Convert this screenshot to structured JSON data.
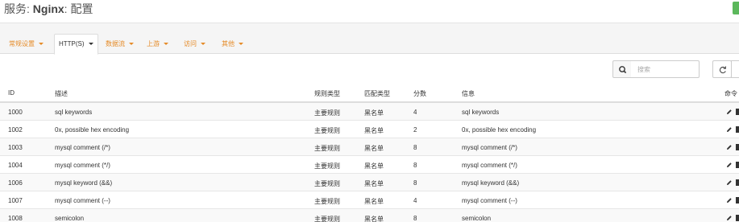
{
  "header": {
    "prefix": "服务: ",
    "service": "Nginx",
    "suffix": ": 配置"
  },
  "tabs": [
    {
      "label": "常规设置",
      "active": false
    },
    {
      "label": "HTTP(S)",
      "active": true
    },
    {
      "label": "数据流",
      "active": false
    },
    {
      "label": "上游",
      "active": false
    },
    {
      "label": "访问",
      "active": false
    },
    {
      "label": "其他",
      "active": false
    }
  ],
  "search": {
    "placeholder": "搜索",
    "icon": "search-icon"
  },
  "refresh_icon": "refresh-icon",
  "table": {
    "columns": {
      "id": "ID",
      "description": "描述",
      "rule_type": "规则类型",
      "match_type": "匹配类型",
      "score": "分数",
      "message": "信息",
      "commands": "命令"
    },
    "rows": [
      {
        "id": "1000",
        "description": "sql keywords",
        "rule_type": "主要规则",
        "match_type": "黑名单",
        "score": "4",
        "message": "sql keywords"
      },
      {
        "id": "1002",
        "description": "0x, possible hex encoding",
        "rule_type": "主要规则",
        "match_type": "黑名单",
        "score": "2",
        "message": "0x, possible hex encoding"
      },
      {
        "id": "1003",
        "description": "mysql comment (/*)",
        "rule_type": "主要规则",
        "match_type": "黑名单",
        "score": "8",
        "message": "mysql comment (/*)"
      },
      {
        "id": "1004",
        "description": "mysql comment (*/)",
        "rule_type": "主要规则",
        "match_type": "黑名单",
        "score": "8",
        "message": "mysql comment (*/)"
      },
      {
        "id": "1006",
        "description": "mysql keyword (&&)",
        "rule_type": "主要规则",
        "match_type": "黑名单",
        "score": "8",
        "message": "mysql keyword (&&)"
      },
      {
        "id": "1007",
        "description": "mysql comment (--)",
        "rule_type": "主要规则",
        "match_type": "黑名单",
        "score": "4",
        "message": "mysql comment (--)"
      },
      {
        "id": "1008",
        "description": "semicolon",
        "rule_type": "主要规则",
        "match_type": "黑名单",
        "score": "8",
        "message": "semicolon"
      }
    ],
    "row_actions": [
      "edit-icon",
      "delete-icon"
    ]
  },
  "colors": {
    "tab_accent": "#e58a26",
    "corner_button": "#5cb85c"
  }
}
